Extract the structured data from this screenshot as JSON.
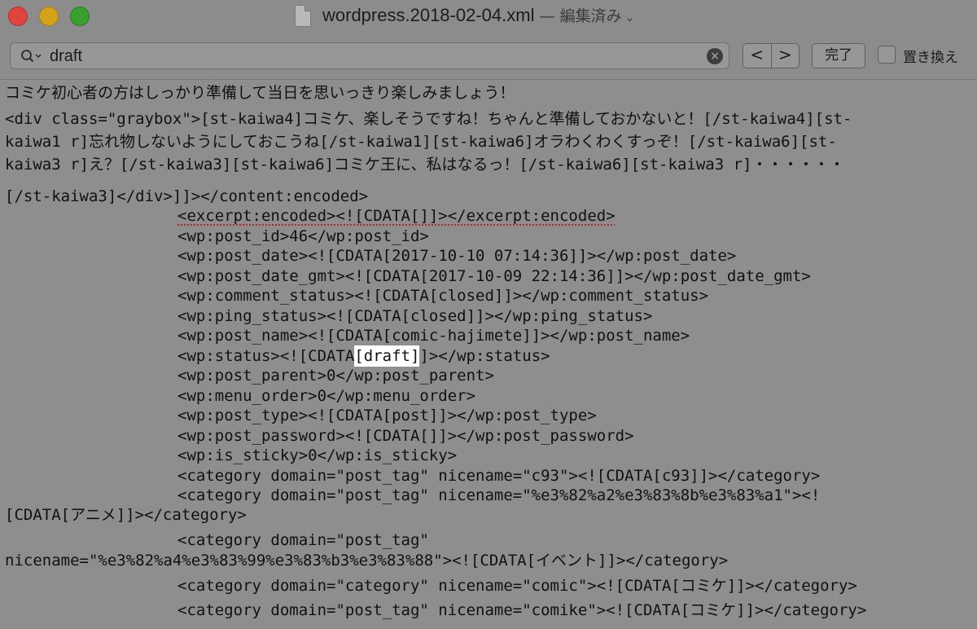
{
  "window": {
    "filename": "wordpress.2018-02-04.xml",
    "status": "— 編集済み",
    "chevron": "⌄"
  },
  "find": {
    "query": "draft",
    "clear": "×",
    "prev": "<",
    "next": ">",
    "done_label": "完了",
    "replace_label": "置き換え"
  },
  "editor": {
    "lines": [
      "コミケ初心者の方はしっかり準備して当日を思いっきり楽しみましょう！",
      "<div class=\"graybox\">[st-kaiwa4]コミケ、楽しそうですね！ちゃんと準備しておかないと！[/st-kaiwa4][st-",
      "kaiwa1 r]忘れ物しないようにしておこうね[/st-kaiwa1][st-kaiwa6]オラわくわくすっぞ！[/st-kaiwa6][st-",
      "kaiwa3 r]え？[/st-kaiwa3][st-kaiwa6]コミケ王に、私はなるっ！[/st-kaiwa6][st-kaiwa3 r]・・・・・・",
      "[/st-kaiwa3]</div>]]></content:encoded>",
      "<excerpt:encoded><![CDATA[]]></excerpt:encoded>",
      "<wp:post_id>46</wp:post_id>",
      "<wp:post_date><![CDATA[2017-10-10 07:14:36]]></wp:post_date>",
      "<wp:post_date_gmt><![CDATA[2017-10-09 22:14:36]]></wp:post_date_gmt>",
      "<wp:comment_status><![CDATA[closed]]></wp:comment_status>",
      "<wp:ping_status><![CDATA[closed]]></wp:ping_status>",
      "<wp:post_name><![CDATA[comic-hajimete]]></wp:post_name>",
      "<wp:post_parent>0</wp:post_parent>",
      "<wp:menu_order>0</wp:menu_order>",
      "<wp:post_type><![CDATA[post]]></wp:post_type>",
      "<wp:post_password><![CDATA[]]></wp:post_password>",
      "<wp:is_sticky>0</wp:is_sticky>",
      "<category domain=\"post_tag\" nicename=\"c93\"><![CDATA[c93]]></category>",
      "<category domain=\"post_tag\" nicename=\"%e3%82%a2%e3%83%8b%e3%83%a1\"><!",
      "[CDATA[アニメ]]></category>",
      "<category domain=\"post_tag\"",
      "nicename=\"%e3%82%a4%e3%83%99%e3%83%b3%e3%83%88\"><![CDATA[イベント]]></category>",
      "<category domain=\"category\" nicename=\"comic\"><![CDATA[コミケ]]></category>",
      "<category domain=\"post_tag\" nicename=\"comike\"><![CDATA[コミケ]]></category>"
    ],
    "status_line": {
      "before": "<wp:status><![CDATA",
      "match": "[draft]",
      "after": "]></wp:status>"
    }
  }
}
